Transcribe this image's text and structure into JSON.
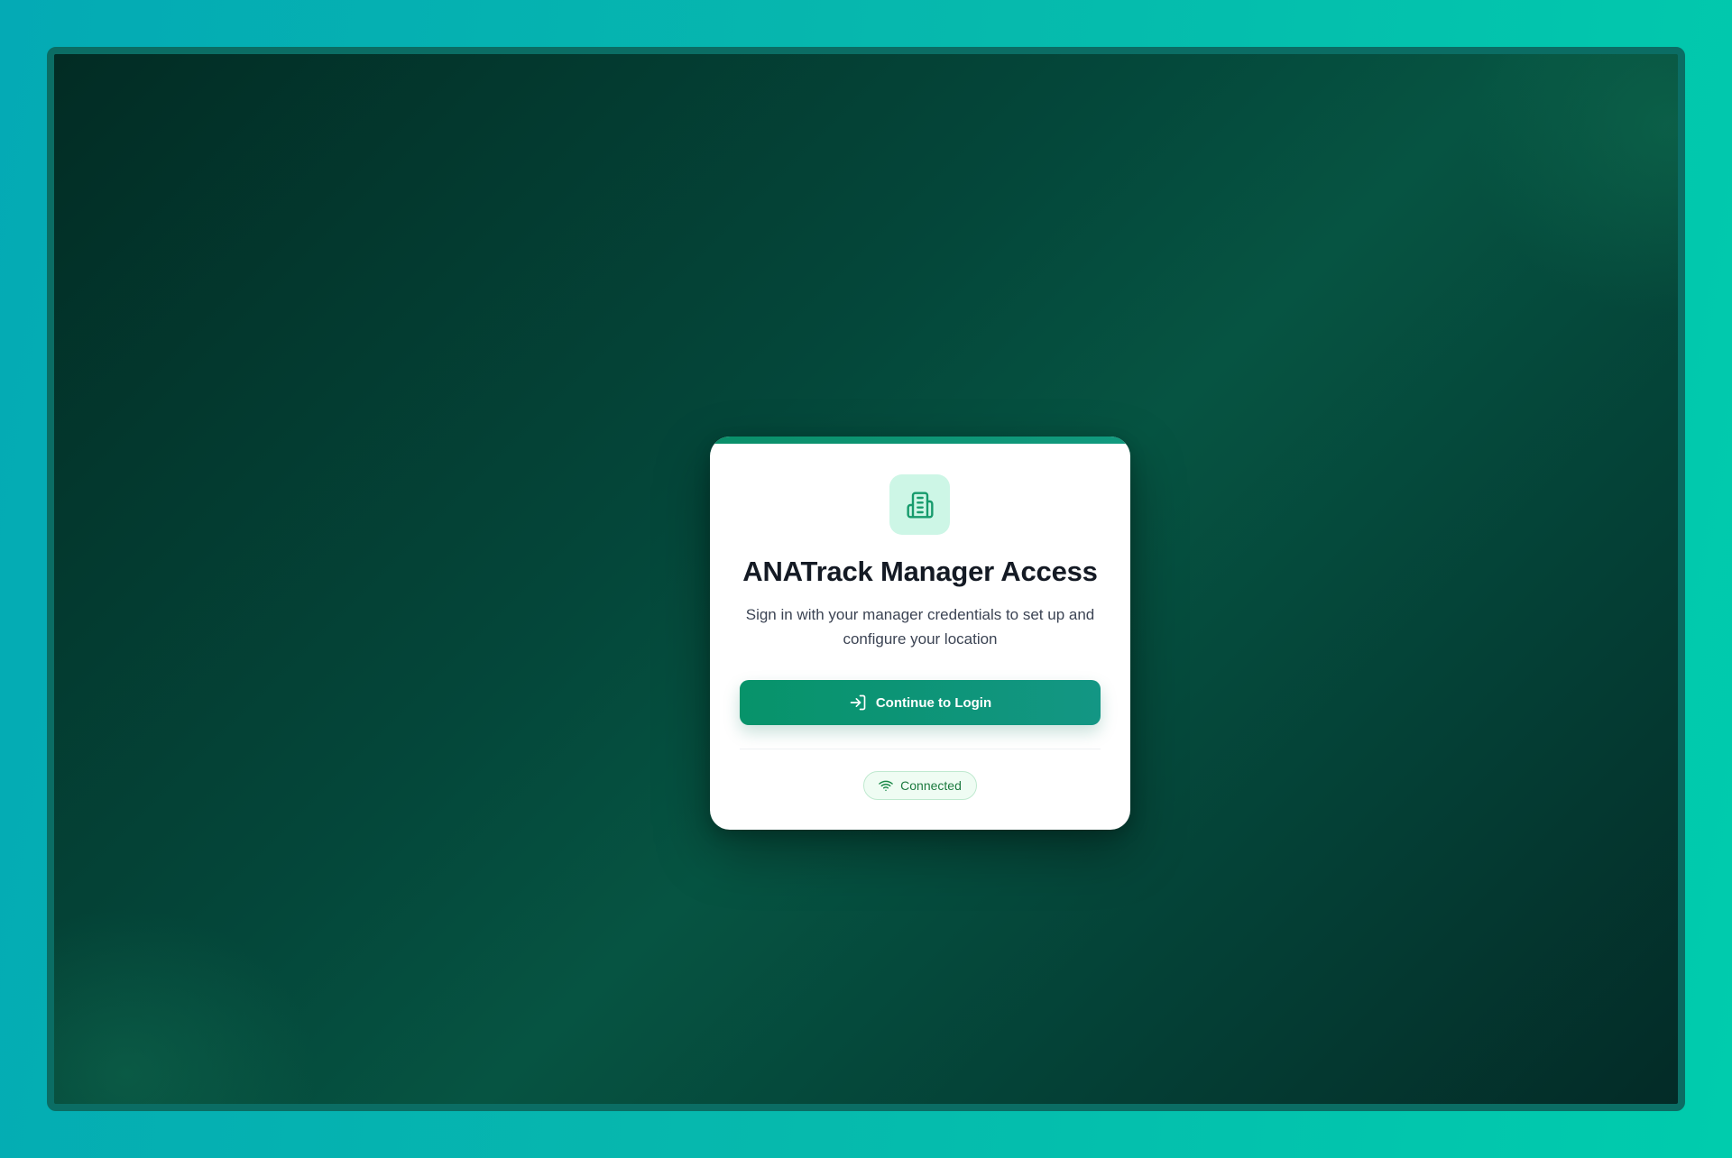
{
  "card": {
    "title": "ANATrack Manager Access",
    "subtitle": "Sign in with your manager credentials to set up and configure your location",
    "login_button_label": "Continue to Login",
    "status_label": "Connected",
    "logo_icon": "building-icon",
    "button_icon": "log-in-icon",
    "status_icon": "wifi-icon"
  },
  "colors": {
    "accent": "#0a8f69",
    "logo_background": "#cdf6e6",
    "status_text": "#1c7a3f",
    "status_background": "#effcf3"
  }
}
